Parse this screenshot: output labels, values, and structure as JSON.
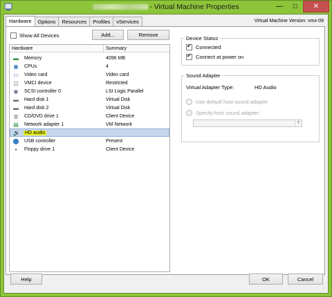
{
  "window": {
    "title": "- Virtual Machine Properties",
    "minimize_glyph": "—",
    "maximize_glyph": "□",
    "close_glyph": "✕"
  },
  "tabs": [
    {
      "label": "Hardware",
      "active": true
    },
    {
      "label": "Options"
    },
    {
      "label": "Resources"
    },
    {
      "label": "Profiles"
    },
    {
      "label": "vServices"
    }
  ],
  "version": "Virtual Machine Version: vmx-09",
  "left": {
    "show_all": "Show All Devices",
    "add": "Add...",
    "remove": "Remove",
    "col_hardware": "Hardware",
    "col_summary": "Summary",
    "rows": [
      {
        "name": "Memory",
        "summary": "4096 MB",
        "icon": "memory-icon",
        "glyph": "▬",
        "color": "#2c8a3a"
      },
      {
        "name": "CPUs",
        "summary": "4",
        "icon": "cpu-icon",
        "glyph": "▣",
        "color": "#3c7fc4"
      },
      {
        "name": "Video card",
        "summary": "Video card",
        "icon": "video-card-icon",
        "glyph": "▭",
        "color": "#3a6fa8"
      },
      {
        "name": "VMCI device",
        "summary": "Restricted",
        "icon": "vmci-device-icon",
        "glyph": "◫",
        "color": "#5a6a86"
      },
      {
        "name": "SCSI controller 0",
        "summary": "LSI Logic Parallel",
        "icon": "scsi-controller-icon",
        "glyph": "◉",
        "color": "#6a6a8a"
      },
      {
        "name": "Hard disk 1",
        "summary": "Virtual Disk",
        "icon": "hard-disk-icon",
        "glyph": "▬",
        "color": "#6a6a6a"
      },
      {
        "name": "Hard disk 2",
        "summary": "Virtual Disk",
        "icon": "hard-disk-icon",
        "glyph": "▬",
        "color": "#6a6a6a"
      },
      {
        "name": "CD/DVD drive 1",
        "summary": "Client Device",
        "icon": "cd-dvd-drive-icon",
        "glyph": "◍",
        "color": "#7a7a7a"
      },
      {
        "name": "Network adapter 1",
        "summary": "VM Network",
        "icon": "network-adapter-icon",
        "glyph": "▤",
        "color": "#2c8a3a"
      },
      {
        "name": "HD audio",
        "summary": "",
        "icon": "audio-icon",
        "glyph": "🔊",
        "color": "#3a3a3a",
        "selected": true,
        "highlight": true
      },
      {
        "name": "USB controller",
        "summary": "Present",
        "icon": "usb-controller-icon",
        "glyph": "⬤",
        "color": "#3c7fc4"
      },
      {
        "name": "Floppy drive 1",
        "summary": "Client Device",
        "icon": "floppy-drive-icon",
        "glyph": "▪",
        "color": "#4a4a4a"
      }
    ]
  },
  "device_status": {
    "title": "Device Status",
    "connected": "Connected",
    "connected_checked": true,
    "connect_at_power_on": "Connect at power on",
    "connect_at_power_on_checked": true
  },
  "sound_adapter": {
    "title": "Sound Adapter",
    "type_label": "Virtual Adapter Type:",
    "type_value": "HD Audio",
    "use_default": "Use default host sound adapter",
    "specify": "Specify host sound adapter:",
    "combo_value": ""
  },
  "footer": {
    "help": "Help",
    "ok": "OK",
    "cancel": "Cancel"
  }
}
